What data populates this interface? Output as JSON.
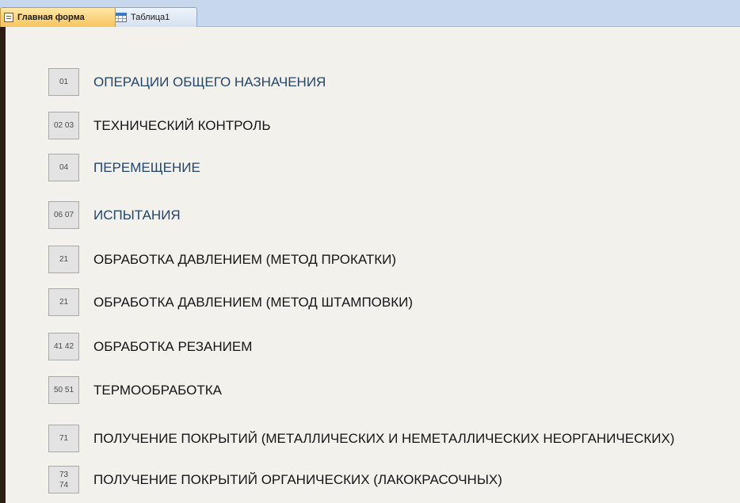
{
  "tabs": [
    {
      "label": "Главная форма",
      "icon": "form-icon",
      "active": true
    },
    {
      "label": "Таблица1",
      "icon": "table-icon",
      "active": false
    }
  ],
  "rows": [
    {
      "code": "01",
      "label": "ОПЕРАЦИИ ОБЩЕГО НАЗНАЧЕНИЯ"
    },
    {
      "code": "02 03",
      "label": "ТЕХНИЧЕСКИЙ КОНТРОЛЬ"
    },
    {
      "code": "04",
      "label": "ПЕРЕМЕЩЕНИЕ"
    },
    {
      "code": "06 07",
      "label": "ИСПЫТАНИЯ"
    },
    {
      "code": "21",
      "label": "ОБРАБОТКА ДАВЛЕНИЕМ (МЕТОД ПРОКАТКИ)"
    },
    {
      "code": "21",
      "label": "ОБРАБОТКА ДАВЛЕНИЕМ (МЕТОД ШТАМПОВКИ)"
    },
    {
      "code": "41 42",
      "label": "ОБРАБОТКА РЕЗАНИЕМ"
    },
    {
      "code": "50 51",
      "label": "ТЕРМООБРАБОТКА"
    },
    {
      "code": "71",
      "label": "ПОЛУЧЕНИЕ ПОКРЫТИЙ (МЕТАЛЛИЧЕСКИХ И НЕМЕТАЛЛИЧЕСКИХ НЕОРГАНИЧЕСКИХ)"
    },
    {
      "code": "73\n74",
      "label": "ПОЛУЧЕНИЕ ПОКРЫТИЙ ОРГАНИЧЕСКИХ (ЛАКОКРАСОЧНЫХ)"
    }
  ],
  "colors": {
    "tab_bar": "#c6d7ee",
    "active_tab": "#f8c45f",
    "background": "#f2f1ec",
    "label_blue": "#24456c",
    "label_dark": "#151515"
  }
}
